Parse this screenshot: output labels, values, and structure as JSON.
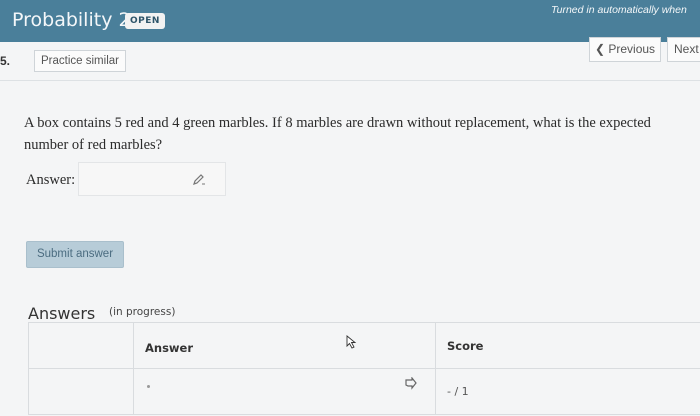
{
  "header": {
    "title": "Probability 2",
    "badge": "OPEN",
    "status": "Turned in automatically when"
  },
  "question": {
    "number": "5.",
    "practice_label": "Practice similar",
    "prev_label": "Previous",
    "next_label": "Next",
    "text": "A box contains 5 red and 4 green marbles. If 8 marbles are drawn without replacement, what is the expected number of red marbles?",
    "answer_label": "Answer:",
    "answer_value": ""
  },
  "submit_label": "Submit answer",
  "answers": {
    "heading": "Answers",
    "subheading": "(in progress)",
    "columns": [
      "Answer",
      "Score"
    ],
    "rows": [
      {
        "answer": "",
        "score": "- / 1"
      }
    ]
  },
  "colors": {
    "header_bg": "#4a7f9a",
    "submit_bg": "#b7ccd8"
  }
}
